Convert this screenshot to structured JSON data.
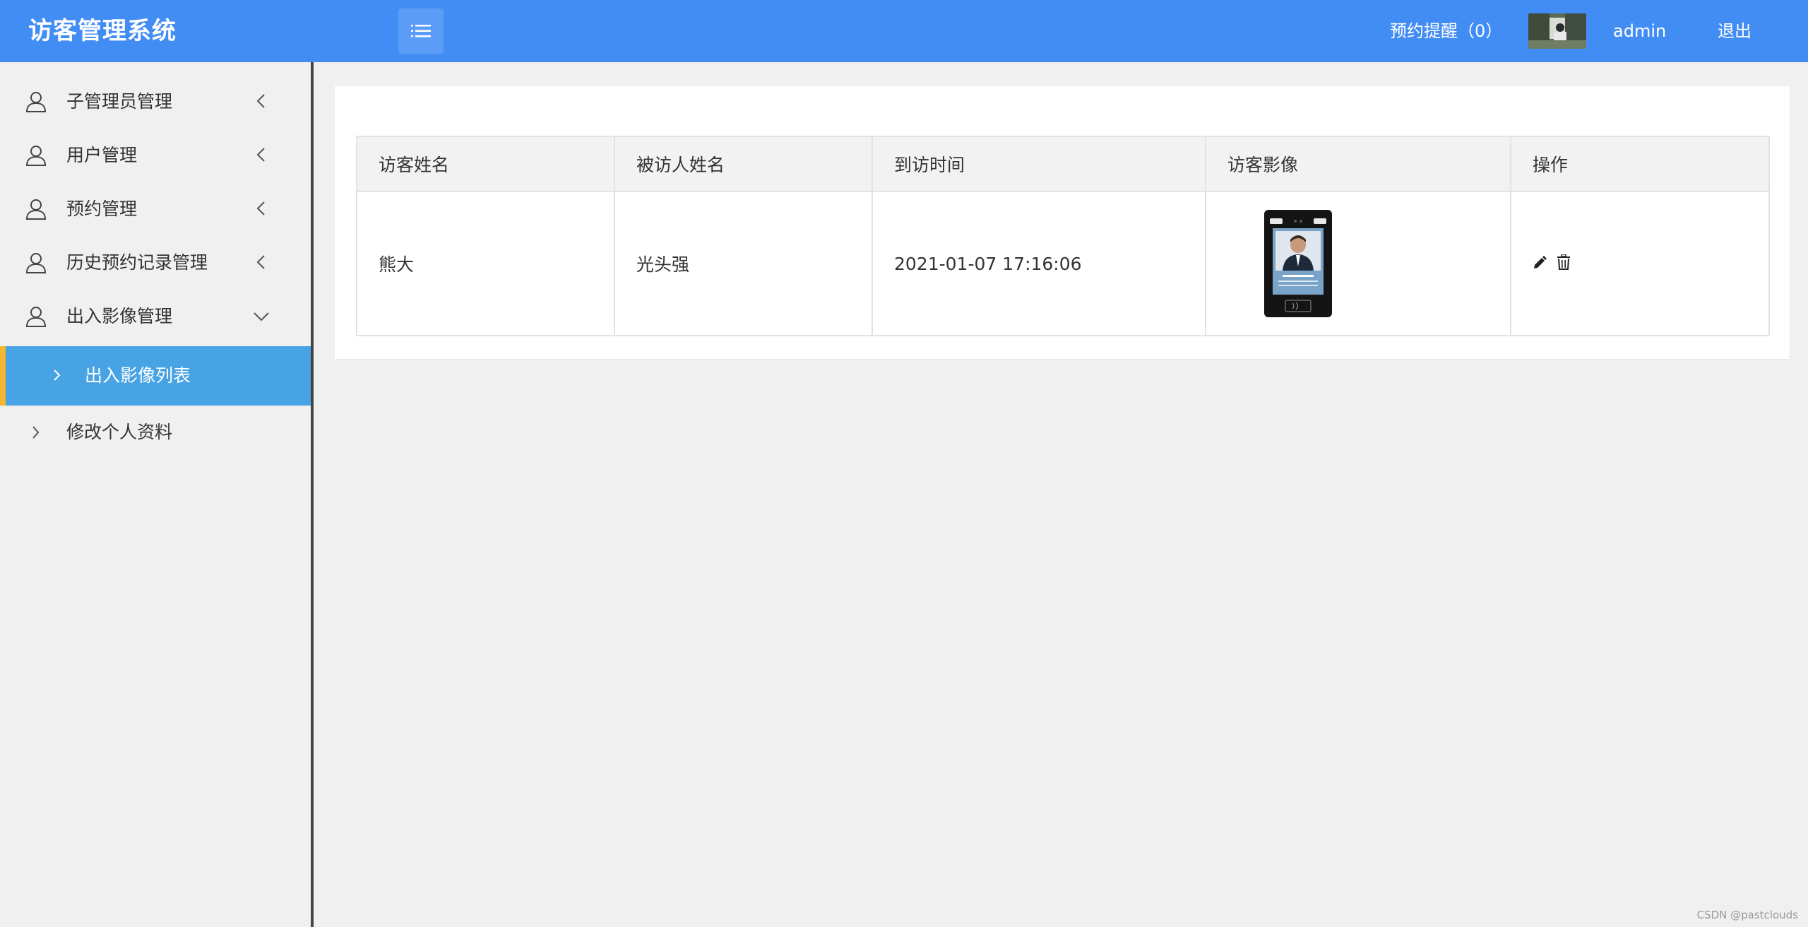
{
  "header": {
    "app_title": "访客管理系统",
    "menu_toggle_icon": "list-icon",
    "reminder_label": "预约提醒（0）",
    "username": "admin",
    "logout_label": "退出"
  },
  "sidebar": {
    "items": [
      {
        "label": "子管理员管理",
        "icon": "user-icon",
        "state": "collapsed"
      },
      {
        "label": "用户管理",
        "icon": "user-icon",
        "state": "collapsed"
      },
      {
        "label": "预约管理",
        "icon": "user-icon",
        "state": "collapsed"
      },
      {
        "label": "历史预约记录管理",
        "icon": "user-icon",
        "state": "collapsed"
      },
      {
        "label": "出入影像管理",
        "icon": "user-icon",
        "state": "expanded"
      }
    ],
    "sub_item": {
      "label": "出入影像列表",
      "active": true
    },
    "profile_label": "修改个人资料"
  },
  "table": {
    "headers": [
      "访客姓名",
      "被访人姓名",
      "到访时间",
      "访客影像",
      "操作"
    ],
    "rows": [
      {
        "visitor": "熊大",
        "host": "光头强",
        "time": "2021-01-07 17:16:06",
        "image": "face-recognition-terminal-photo",
        "actions": [
          "edit-icon",
          "trash-icon"
        ]
      }
    ]
  },
  "colors": {
    "header": "#428df4",
    "active_menu": "#48a3e4",
    "active_bar": "#f4b731"
  },
  "watermark": "CSDN @pastclouds"
}
